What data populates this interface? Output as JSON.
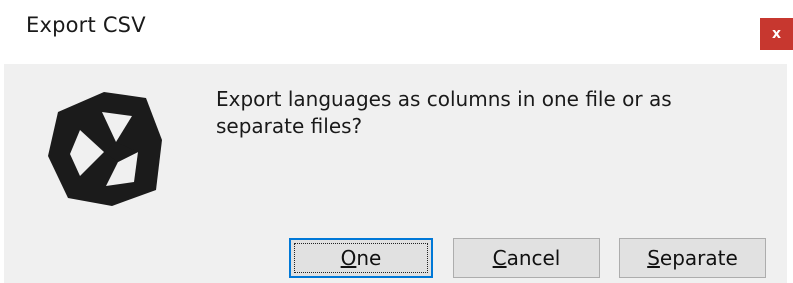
{
  "window": {
    "title": "Export CSV",
    "close_label": "x"
  },
  "message": {
    "text": "Export languages as columns in one file or as separate files?"
  },
  "buttons": {
    "one": {
      "mnemonic": "O",
      "rest": "ne"
    },
    "cancel": {
      "mnemonic": "C",
      "rest": "ancel"
    },
    "separate": {
      "mnemonic": "S",
      "rest": "eparate"
    }
  },
  "icon": {
    "name": "unity-logo-icon"
  },
  "colors": {
    "close_button": "#c7372f",
    "dialog_body": "#f0f0f0",
    "focus_border": "#0078d7",
    "button_face": "#e1e1e1"
  }
}
